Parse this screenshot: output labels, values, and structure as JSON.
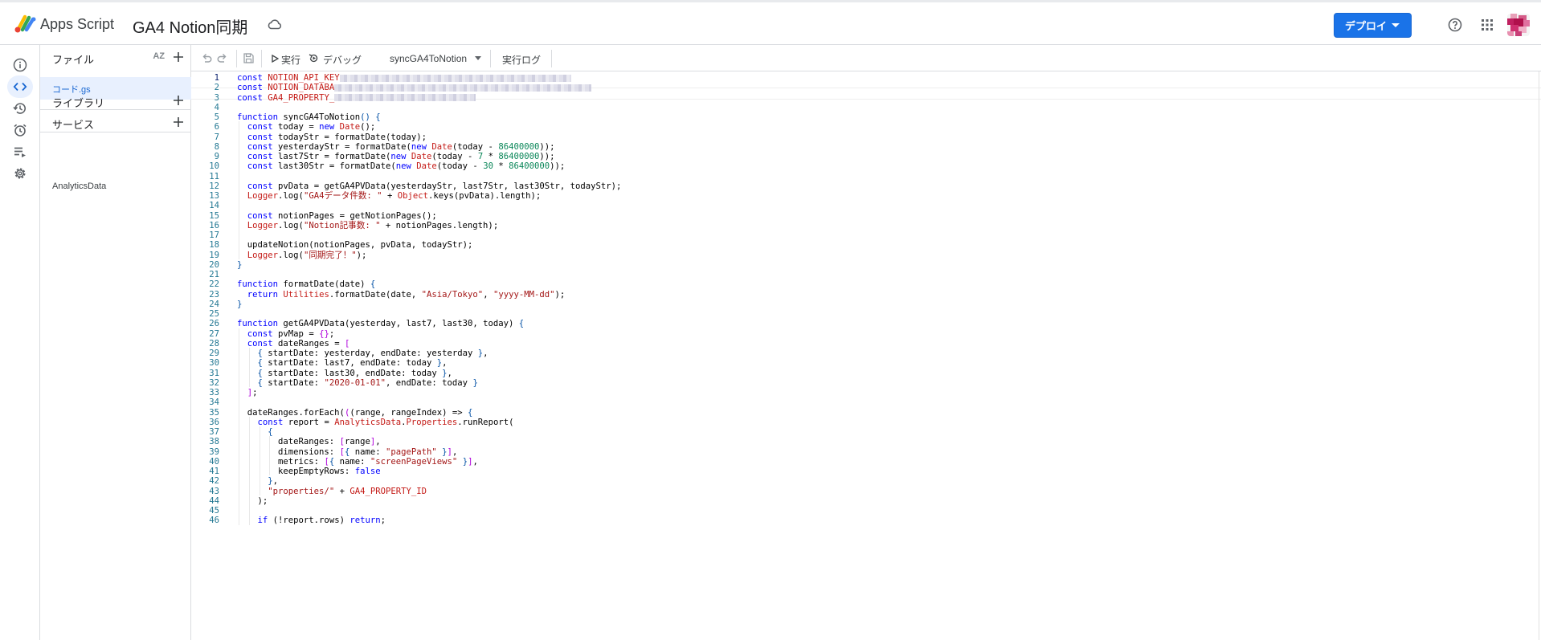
{
  "topbar": {
    "app_name": "Apps Script",
    "project_title": "GA4 Notion同期",
    "deploy_label": "デプロイ"
  },
  "files": {
    "files_header": "ファイル",
    "sort_label": "AZ",
    "active_file": "コード.gs",
    "libraries_header": "ライブラリ",
    "services_header": "サービス",
    "services": [
      "AnalyticsData"
    ]
  },
  "toolbar": {
    "run_label": "実行",
    "debug_label": "デバッグ",
    "function_name": "syncGA4ToNotion",
    "log_label": "実行ログ"
  },
  "icons": {
    "rail": [
      "info-icon",
      "code-icon",
      "history-icon",
      "alarm-icon",
      "executions-icon",
      "settings-icon"
    ],
    "toolbar": [
      "undo-icon",
      "redo-icon",
      "save-icon",
      "play-icon",
      "debug-icon"
    ]
  },
  "colors": {
    "accent": "#1a73e8",
    "keyword": "#0000ff",
    "string": "#a31515",
    "number": "#098658",
    "builtin": "#c41a16"
  },
  "code": {
    "current_line": 1,
    "lines": [
      [
        [
          "k",
          "const "
        ],
        [
          "c",
          "NOTION_API_KEY"
        ],
        [
          "blur",
          "180"
        ]
      ],
      [
        [
          "k",
          "const "
        ],
        [
          "c",
          "NOTION_DATABA"
        ],
        [
          "blur",
          "200"
        ]
      ],
      [
        [
          "k",
          "const "
        ],
        [
          "c",
          "GA4_PROPERTY_"
        ],
        [
          "blur",
          "110"
        ]
      ],
      [],
      [
        [
          "k",
          "function "
        ],
        [
          "p",
          "syncGA4ToNotion"
        ],
        [
          "o",
          "() {"
        ]
      ],
      [
        [
          "p",
          "  "
        ],
        [
          "k",
          "const "
        ],
        [
          "p",
          "today = "
        ],
        [
          "k",
          "new "
        ],
        [
          "c",
          "Date"
        ],
        [
          "p",
          "();"
        ]
      ],
      [
        [
          "p",
          "  "
        ],
        [
          "k",
          "const "
        ],
        [
          "p",
          "todayStr = formatDate(today);"
        ]
      ],
      [
        [
          "p",
          "  "
        ],
        [
          "k",
          "const "
        ],
        [
          "p",
          "yesterdayStr = formatDate("
        ],
        [
          "k",
          "new "
        ],
        [
          "c",
          "Date"
        ],
        [
          "p",
          "(today - "
        ],
        [
          "n",
          "86400000"
        ],
        [
          "p",
          "));"
        ]
      ],
      [
        [
          "p",
          "  "
        ],
        [
          "k",
          "const "
        ],
        [
          "p",
          "last7Str = formatDate("
        ],
        [
          "k",
          "new "
        ],
        [
          "c",
          "Date"
        ],
        [
          "p",
          "(today - "
        ],
        [
          "n",
          "7"
        ],
        [
          "p",
          " * "
        ],
        [
          "n",
          "86400000"
        ],
        [
          "p",
          "));"
        ]
      ],
      [
        [
          "p",
          "  "
        ],
        [
          "k",
          "const "
        ],
        [
          "p",
          "last30Str = formatDate("
        ],
        [
          "k",
          "new "
        ],
        [
          "c",
          "Date"
        ],
        [
          "p",
          "(today - "
        ],
        [
          "n",
          "30"
        ],
        [
          "p",
          " * "
        ],
        [
          "n",
          "86400000"
        ],
        [
          "p",
          "));"
        ]
      ],
      [],
      [
        [
          "p",
          "  "
        ],
        [
          "k",
          "const "
        ],
        [
          "p",
          "pvData = getGA4PVData(yesterdayStr, last7Str, last30Str, todayStr);"
        ]
      ],
      [
        [
          "p",
          "  "
        ],
        [
          "c",
          "Logger"
        ],
        [
          "p",
          ".log("
        ],
        [
          "s",
          "\"GA4データ件数: \""
        ],
        [
          "p",
          " + "
        ],
        [
          "c",
          "Object"
        ],
        [
          "p",
          ".keys(pvData).length);"
        ]
      ],
      [],
      [
        [
          "p",
          "  "
        ],
        [
          "k",
          "const "
        ],
        [
          "p",
          "notionPages = getNotionPages();"
        ]
      ],
      [
        [
          "p",
          "  "
        ],
        [
          "c",
          "Logger"
        ],
        [
          "p",
          ".log("
        ],
        [
          "s",
          "\"Notion記事数: \""
        ],
        [
          "p",
          " + notionPages.length);"
        ]
      ],
      [],
      [
        [
          "p",
          "  updateNotion(notionPages, pvData, todayStr);"
        ]
      ],
      [
        [
          "p",
          "  "
        ],
        [
          "c",
          "Logger"
        ],
        [
          "p",
          ".log("
        ],
        [
          "s",
          "\"同期完了！\""
        ],
        [
          "p",
          ");"
        ]
      ],
      [
        [
          "o",
          "}"
        ]
      ],
      [],
      [
        [
          "k",
          "function "
        ],
        [
          "p",
          "formatDate(date) "
        ],
        [
          "o",
          "{"
        ]
      ],
      [
        [
          "p",
          "  "
        ],
        [
          "k",
          "return "
        ],
        [
          "c",
          "Utilities"
        ],
        [
          "p",
          ".formatDate(date, "
        ],
        [
          "s",
          "\"Asia/Tokyo\""
        ],
        [
          "p",
          ", "
        ],
        [
          "s",
          "\"yyyy-MM-dd\""
        ],
        [
          "p",
          ");"
        ]
      ],
      [
        [
          "o",
          "}"
        ]
      ],
      [],
      [
        [
          "k",
          "function "
        ],
        [
          "p",
          "getGA4PVData(yesterday, last7, last30, today) "
        ],
        [
          "o",
          "{"
        ]
      ],
      [
        [
          "p",
          "  "
        ],
        [
          "k",
          "const "
        ],
        [
          "p",
          "pvMap = "
        ],
        [
          "y",
          "{}"
        ],
        [
          "p",
          ";"
        ]
      ],
      [
        [
          "p",
          "  "
        ],
        [
          "k",
          "const "
        ],
        [
          "p",
          "dateRanges = "
        ],
        [
          "y",
          "["
        ]
      ],
      [
        [
          "p",
          "    "
        ],
        [
          "o",
          "{ "
        ],
        [
          "p",
          "startDate: yesterday, endDate: yesterday "
        ],
        [
          "o",
          "}"
        ],
        [
          "p",
          ","
        ]
      ],
      [
        [
          "p",
          "    "
        ],
        [
          "o",
          "{ "
        ],
        [
          "p",
          "startDate: last7, endDate: today "
        ],
        [
          "o",
          "}"
        ],
        [
          "p",
          ","
        ]
      ],
      [
        [
          "p",
          "    "
        ],
        [
          "o",
          "{ "
        ],
        [
          "p",
          "startDate: last30, endDate: today "
        ],
        [
          "o",
          "}"
        ],
        [
          "p",
          ","
        ]
      ],
      [
        [
          "p",
          "    "
        ],
        [
          "o",
          "{ "
        ],
        [
          "p",
          "startDate: "
        ],
        [
          "s",
          "\"2020-01-01\""
        ],
        [
          "p",
          ", endDate: today "
        ],
        [
          "o",
          "}"
        ]
      ],
      [
        [
          "p",
          "  "
        ],
        [
          "y",
          "]"
        ],
        [
          "p",
          ";"
        ]
      ],
      [],
      [
        [
          "p",
          "  dateRanges.forEach("
        ],
        [
          "y",
          "("
        ],
        [
          "p",
          "(range, rangeIndex) => "
        ],
        [
          "o",
          "{"
        ]
      ],
      [
        [
          "p",
          "    "
        ],
        [
          "k",
          "const "
        ],
        [
          "p",
          "report = "
        ],
        [
          "c",
          "AnalyticsData"
        ],
        [
          "p",
          "."
        ],
        [
          "c",
          "Properties"
        ],
        [
          "p",
          ".runReport("
        ]
      ],
      [
        [
          "p",
          "      "
        ],
        [
          "o",
          "{"
        ]
      ],
      [
        [
          "p",
          "        dateRanges: "
        ],
        [
          "y",
          "["
        ],
        [
          "p",
          "range"
        ],
        [
          "y",
          "]"
        ],
        [
          "p",
          ","
        ]
      ],
      [
        [
          "p",
          "        dimensions: "
        ],
        [
          "y",
          "["
        ],
        [
          "o",
          "{ "
        ],
        [
          "p",
          "name: "
        ],
        [
          "s",
          "\"pagePath\""
        ],
        [
          "o",
          " }"
        ],
        [
          "y",
          "]"
        ],
        [
          "p",
          ","
        ]
      ],
      [
        [
          "p",
          "        metrics: "
        ],
        [
          "y",
          "["
        ],
        [
          "o",
          "{ "
        ],
        [
          "p",
          "name: "
        ],
        [
          "s",
          "\"screenPageViews\""
        ],
        [
          "o",
          " }"
        ],
        [
          "y",
          "]"
        ],
        [
          "p",
          ","
        ]
      ],
      [
        [
          "p",
          "        keepEmptyRows: "
        ],
        [
          "k",
          "false"
        ]
      ],
      [
        [
          "p",
          "      "
        ],
        [
          "o",
          "}"
        ],
        [
          "p",
          ","
        ]
      ],
      [
        [
          "p",
          "      "
        ],
        [
          "s",
          "\"properties/\""
        ],
        [
          "p",
          " + "
        ],
        [
          "c",
          "GA4_PROPERTY_ID"
        ]
      ],
      [
        [
          "p",
          "    );"
        ]
      ],
      [],
      [
        [
          "p",
          "    "
        ],
        [
          "k",
          "if "
        ],
        [
          "p",
          "(!report.rows) "
        ],
        [
          "k",
          "return"
        ],
        [
          "p",
          ";"
        ]
      ]
    ]
  }
}
